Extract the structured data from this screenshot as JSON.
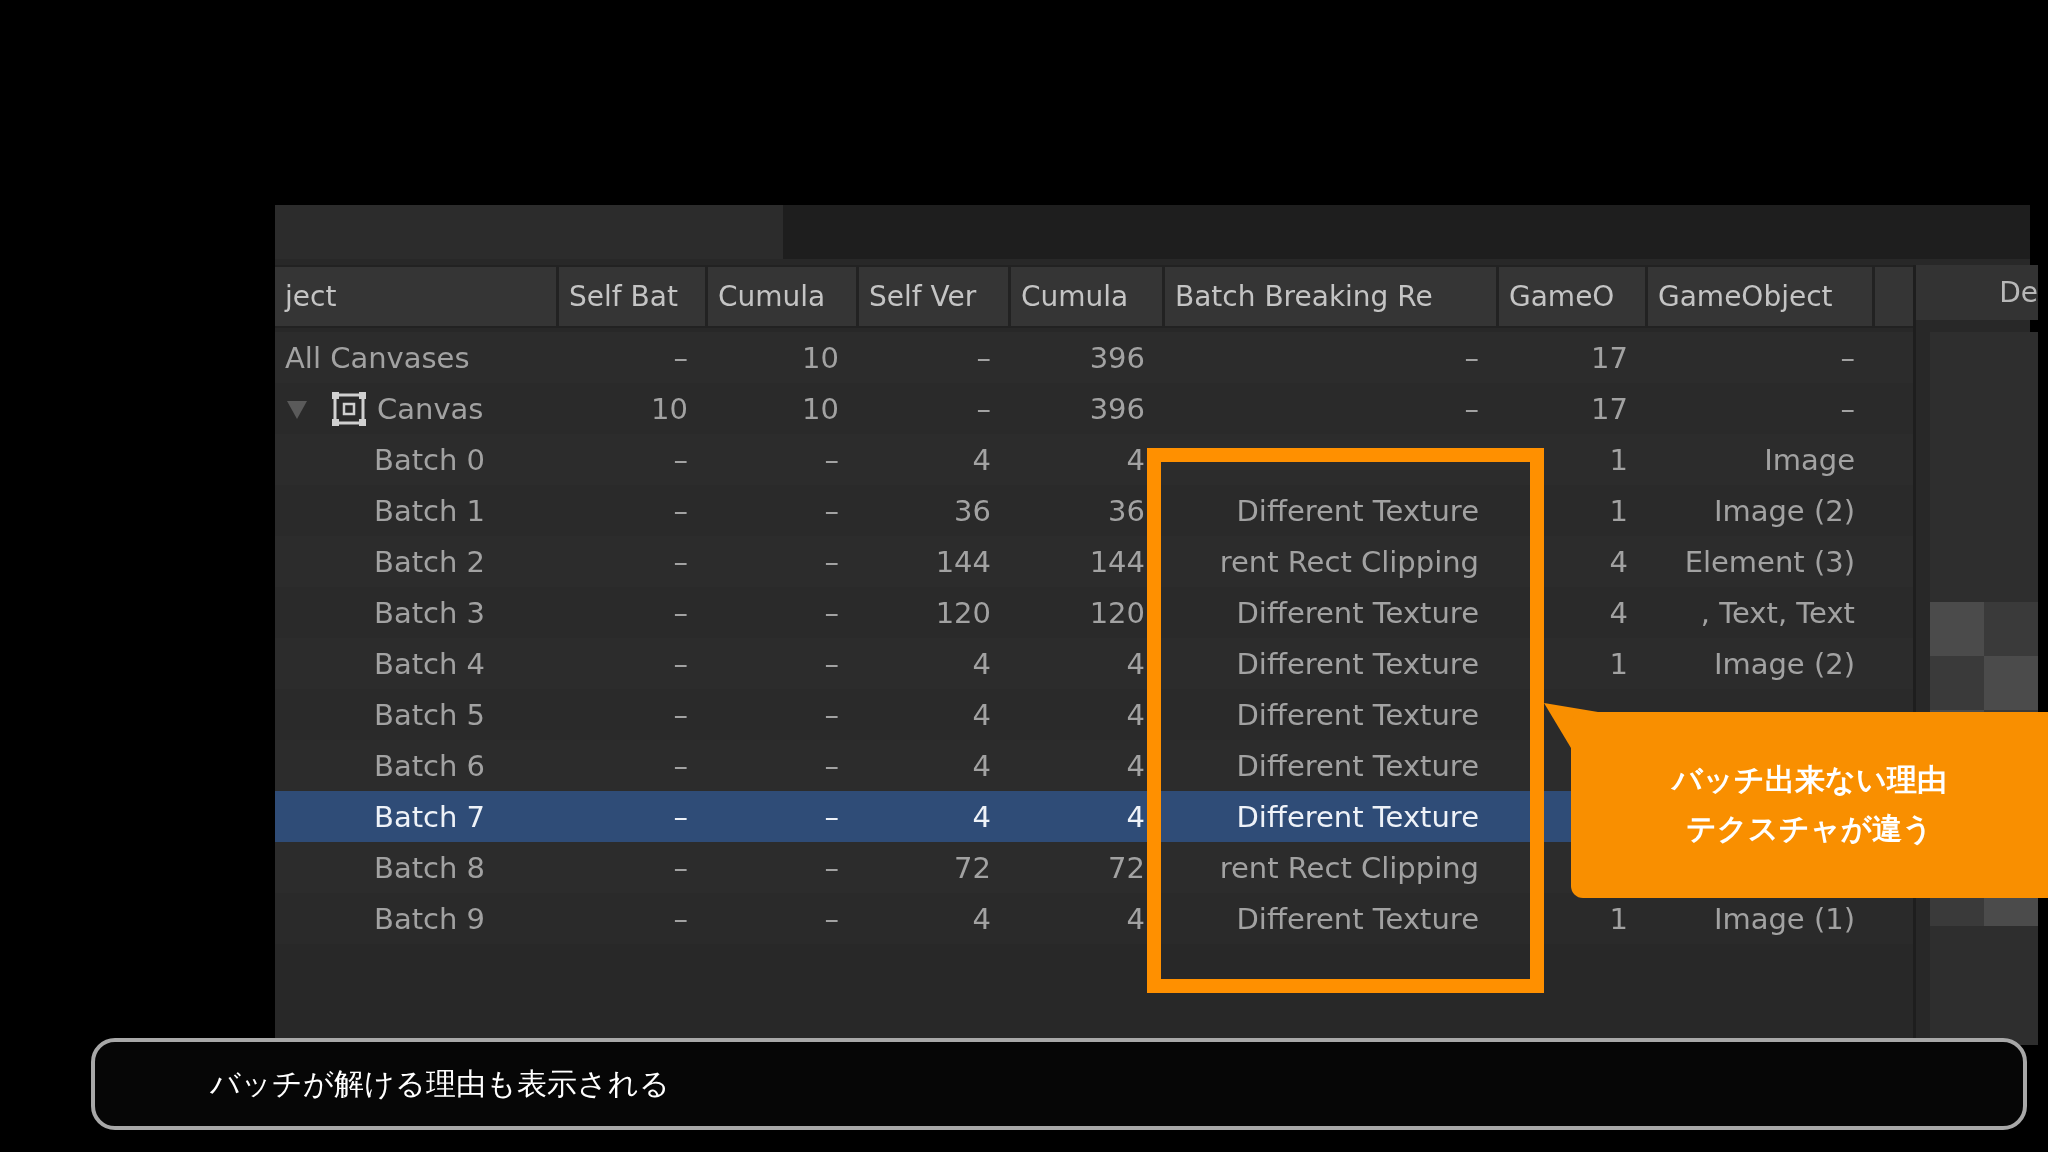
{
  "table": {
    "columns": [
      "ject",
      "Self Bat",
      "Cumula",
      "Self Ver",
      "Cumula",
      "Batch Breaking Re",
      "GameO",
      "GameObject"
    ],
    "rows": [
      {
        "kind": "total",
        "selected": false,
        "cells": [
          "All Canvases",
          "–",
          "10",
          "–",
          "396",
          "–",
          "17",
          "–"
        ]
      },
      {
        "kind": "canvas",
        "selected": false,
        "expanded": true,
        "cells": [
          "Canvas",
          "10",
          "10",
          "–",
          "396",
          "–",
          "17",
          "–"
        ]
      },
      {
        "kind": "batch",
        "selected": false,
        "cells": [
          "Batch 0",
          "–",
          "–",
          "4",
          "4",
          "",
          "1",
          "Image"
        ]
      },
      {
        "kind": "batch",
        "selected": false,
        "cells": [
          "Batch 1",
          "–",
          "–",
          "36",
          "36",
          "Different Texture",
          "1",
          "Image (2)"
        ]
      },
      {
        "kind": "batch",
        "selected": false,
        "cells": [
          "Batch 2",
          "–",
          "–",
          "144",
          "144",
          "rent Rect Clipping",
          "4",
          "Element (3)"
        ]
      },
      {
        "kind": "batch",
        "selected": false,
        "cells": [
          "Batch 3",
          "–",
          "–",
          "120",
          "120",
          "Different Texture",
          "4",
          ", Text, Text"
        ]
      },
      {
        "kind": "batch",
        "selected": false,
        "cells": [
          "Batch 4",
          "–",
          "–",
          "4",
          "4",
          "Different Texture",
          "1",
          "Image (2)"
        ]
      },
      {
        "kind": "batch",
        "selected": false,
        "cells": [
          "Batch 5",
          "–",
          "–",
          "4",
          "4",
          "Different Texture",
          "",
          ""
        ]
      },
      {
        "kind": "batch",
        "selected": false,
        "cells": [
          "Batch 6",
          "–",
          "–",
          "4",
          "4",
          "Different Texture",
          "",
          ""
        ]
      },
      {
        "kind": "batch",
        "selected": true,
        "cells": [
          "Batch 7",
          "–",
          "–",
          "4",
          "4",
          "Different Texture",
          "",
          ""
        ]
      },
      {
        "kind": "batch",
        "selected": false,
        "cells": [
          "Batch 8",
          "–",
          "–",
          "72",
          "72",
          "rent Rect Clipping",
          "",
          ""
        ]
      },
      {
        "kind": "batch",
        "selected": false,
        "cells": [
          "Batch 9",
          "–",
          "–",
          "4",
          "4",
          "Different Texture",
          "1",
          "Image (1)"
        ]
      }
    ]
  },
  "side_panel": {
    "header": "De"
  },
  "callout": {
    "lines": [
      "バッチ出来ない理由",
      "テクスチャが違う"
    ]
  },
  "caption": "バッチが解ける理由も表示される"
}
